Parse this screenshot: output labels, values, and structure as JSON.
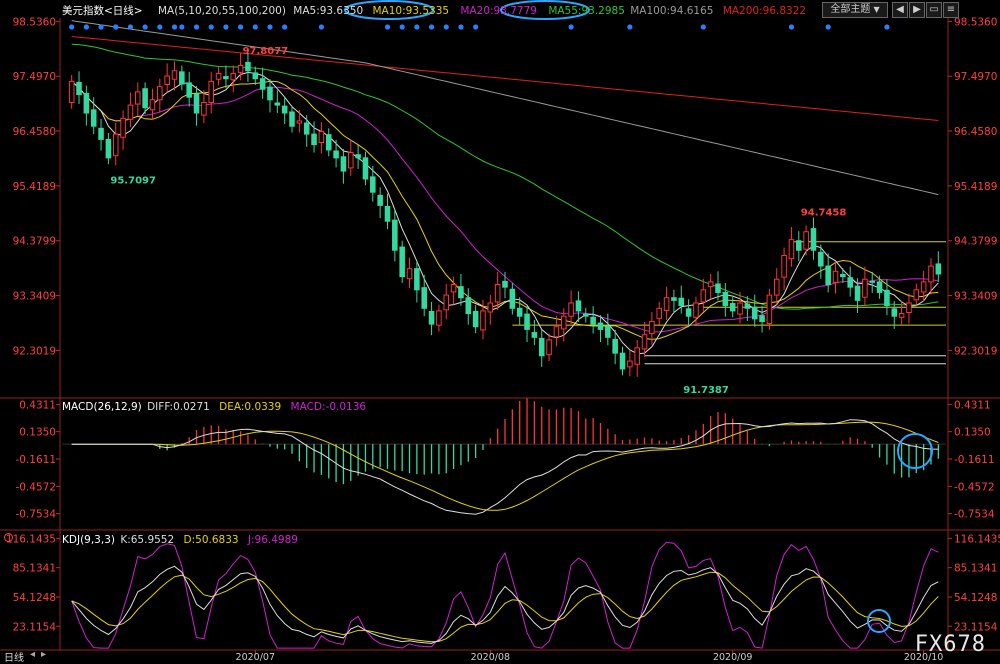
{
  "header": {
    "symbol": "美元指数<日线>",
    "ma_params": "MA(5,10,20,55,100,200)",
    "ma5": "MA5:93.6350",
    "ma10": "MA10:93.5335",
    "ma20": "MA20:93.7779",
    "ma55": "MA55:93.2985",
    "ma100": "MA100:94.6165",
    "ma200": "MA200:96.8322",
    "theme_select": "全部主题",
    "theme_arrow": "▼"
  },
  "macd_header": {
    "title": "MACD(26,12,9)",
    "diff": "DIFF:0.0271",
    "dea": "DEA:0.0339",
    "macd": "MACD:-0.0136"
  },
  "kdj_header": {
    "title": "KDJ(9,3,3)",
    "k": "K:65.9552",
    "d": "D:50.6833",
    "j": "J:96.4989"
  },
  "tab_label": "日线",
  "brand": "FX678",
  "colors": {
    "up": "#ff3333",
    "down": "#33d9a0",
    "ma5": "#dddddd",
    "ma10": "#e6d200",
    "ma20": "#d020d0",
    "ma55": "#2ec52e",
    "ma100": "#9a9a9a",
    "ma200": "#e0201c"
  },
  "chart_data": [
    {
      "type": "candlestick",
      "title": "美元指数<日线>",
      "y_ticks": [
        98.536,
        97.497,
        96.458,
        95.4189,
        94.3799,
        93.3409,
        92.3019
      ],
      "y_tick_labels": [
        "98.5360",
        "97.4970",
        "96.4580",
        "95.4189",
        "94.3799",
        "93.3409",
        "92.3019"
      ],
      "ylim": [
        91.4,
        98.6
      ],
      "x_labels": [
        "2020/07",
        "2020/08",
        "2020/09",
        "2020/10"
      ],
      "annotations": [
        {
          "text": "97.8077",
          "value": 97.8077
        },
        {
          "text": "95.7097",
          "value": 95.7097
        },
        {
          "text": "94.7458",
          "value": 94.7458
        },
        {
          "text": "91.7387",
          "value": 91.7387
        }
      ],
      "horizontal_levels": [
        94.36,
        93.12,
        92.78,
        92.2,
        92.05
      ],
      "closes": [
        97.4,
        97.15,
        96.8,
        96.55,
        96.3,
        95.95,
        96.4,
        96.7,
        96.95,
        97.2,
        96.9,
        97.05,
        97.3,
        97.5,
        97.6,
        97.35,
        97.1,
        96.8,
        97.0,
        97.4,
        97.55,
        97.45,
        97.55,
        97.7,
        97.6,
        97.45,
        97.25,
        97.05,
        96.95,
        96.8,
        96.55,
        96.65,
        96.4,
        96.2,
        96.45,
        96.1,
        95.95,
        95.7,
        96.05,
        95.95,
        95.55,
        95.3,
        95.05,
        94.75,
        94.2,
        93.7,
        93.85,
        93.45,
        93.1,
        92.8,
        93.05,
        93.35,
        93.55,
        93.3,
        93.0,
        92.75,
        93.05,
        93.2,
        93.55,
        93.5,
        93.1,
        92.95,
        92.7,
        92.55,
        92.2,
        92.5,
        92.75,
        92.95,
        93.2,
        93.05,
        92.95,
        92.8,
        92.7,
        92.55,
        92.25,
        91.95,
        92.1,
        92.35,
        92.6,
        92.85,
        93.1,
        93.3,
        93.25,
        93.15,
        92.95,
        93.2,
        93.45,
        93.6,
        93.4,
        93.15,
        93.05,
        93.2,
        93.1,
        92.9,
        92.85,
        93.35,
        93.65,
        94.1,
        94.4,
        94.2,
        94.55,
        94.2,
        93.9,
        93.55,
        93.8,
        93.7,
        93.5,
        93.25,
        93.65,
        93.6,
        93.4,
        93.15,
        92.95,
        93.0,
        93.2,
        93.45,
        93.6,
        93.9,
        93.75
      ]
    },
    {
      "type": "macd",
      "title": "MACD(26,12,9)",
      "y_tick_labels": [
        "0.4311",
        "0.1350",
        "-0.1611",
        "-0.4572",
        "-0.7534"
      ],
      "y_ticks": [
        0.4311,
        0.135,
        -0.1611,
        -0.4572,
        -0.7534
      ],
      "ylim": [
        -0.93,
        0.5
      ],
      "diff": 0.0271,
      "dea": 0.0339,
      "macd": -0.0136
    },
    {
      "type": "kdj",
      "title": "KDJ(9,3,3)",
      "y_tick_labels": [
        "116.1435",
        "85.1341",
        "54.1248",
        "23.1154"
      ],
      "y_ticks": [
        116.1435,
        85.1341,
        54.1248,
        23.1154
      ],
      "ylim": [
        -2,
        125
      ],
      "k": 65.9552,
      "d": 50.6833,
      "j": 96.4989
    }
  ]
}
